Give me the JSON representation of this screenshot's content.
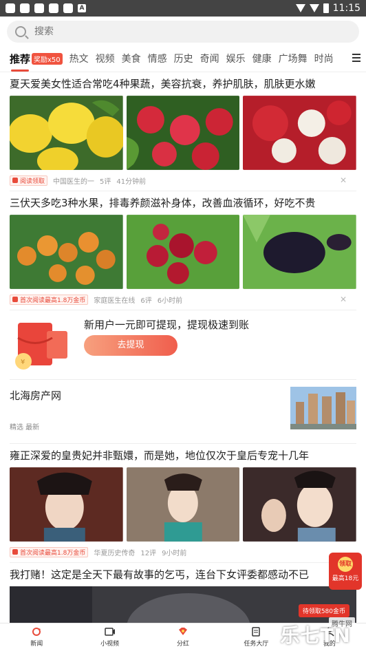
{
  "status_bar": {
    "time": "11:15"
  },
  "search": {
    "placeholder": "搜索"
  },
  "tabs": [
    {
      "label": "推荐",
      "active": true
    },
    {
      "label": "热文"
    },
    {
      "label": "视频"
    },
    {
      "label": "美食"
    },
    {
      "label": "情感"
    },
    {
      "label": "历史"
    },
    {
      "label": "奇闻"
    },
    {
      "label": "娱乐"
    },
    {
      "label": "健康"
    },
    {
      "label": "广场舞"
    },
    {
      "label": "时尚"
    }
  ],
  "reward_badge": "奖励x50",
  "articles": [
    {
      "title": "夏天爱美女性适合常吃4种果蔬，美容抗衰，养护肌肤，肌肤更水嫩",
      "tag": "阅读领取",
      "source": "中国医生的一",
      "comments": "5评",
      "time": "41分钟前"
    },
    {
      "title": "三伏天多吃3种水果，排毒养颜滋补身体，改善血液循环，好吃不贵",
      "tag": "首次阅读最高1.8万金币",
      "source": "家庭医生在线",
      "comments": "6评",
      "time": "6小时前"
    },
    {
      "title": "雍正深爱的皇贵妃并非甄嬛，而是她，地位仅次于皇后专宠十几年",
      "tag": "首次阅读最高1.8万金币",
      "source": "华夏历史传奇",
      "comments": "12评",
      "time": "9小时前"
    },
    {
      "title": "我打赌！这定是全天下最有故事的乞丐，连台下女评委都感动不已"
    }
  ],
  "promo": {
    "title": "新用户一元即可提现，提现极速到账",
    "button": "去提现"
  },
  "ad": {
    "title": "北海房产网",
    "sub": "精选 最新"
  },
  "floating_ad": {
    "top": "领取",
    "bottom": "最高18元"
  },
  "banner_tag": "待领取580金币",
  "bottom_nav": [
    {
      "label": "新闻",
      "icon": "refresh-icon"
    },
    {
      "label": "小视频",
      "icon": "video-icon"
    },
    {
      "label": "分红",
      "icon": "bonus-icon"
    },
    {
      "label": "任务大厅",
      "icon": "task-icon"
    },
    {
      "label": "我的",
      "icon": "user-icon"
    }
  ],
  "watermark": {
    "main": "乐七TN",
    "small": "腾牛网"
  },
  "colors": {
    "accent": "#e84a3a"
  }
}
